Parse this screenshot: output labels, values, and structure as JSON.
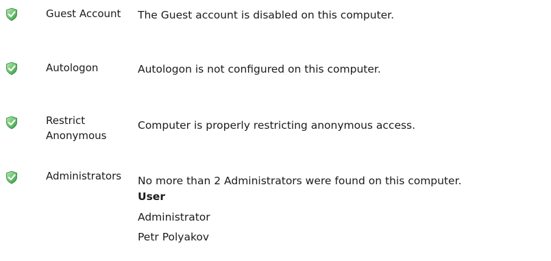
{
  "status_icon": "green-shield-check-icon",
  "colors": {
    "shield_light": "#8fd88a",
    "shield_dark": "#2e9c3a",
    "check": "#ffffff"
  },
  "checks": [
    {
      "name": "Guest Account",
      "description": "The Guest account is disabled on this computer."
    },
    {
      "name": "Autologon",
      "description": "Autologon is not configured on this computer."
    },
    {
      "name": "Restrict Anonymous",
      "description": "Computer is properly restricting anonymous access."
    },
    {
      "name": "Administrators",
      "description": "No more than 2 Administrators were found on this computer.",
      "user_header": "User",
      "users": [
        "Administrator",
        "Petr Polyakov"
      ]
    }
  ]
}
